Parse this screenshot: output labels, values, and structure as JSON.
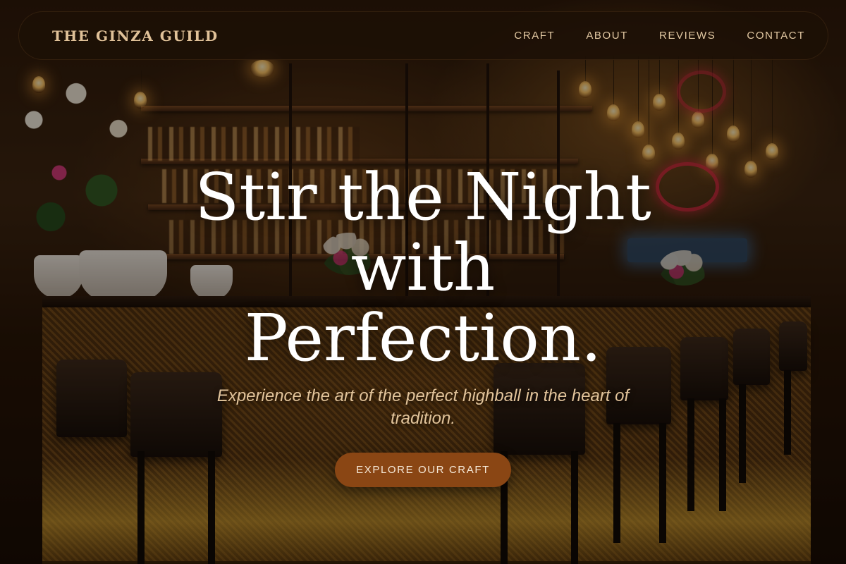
{
  "brand": {
    "name": "THE GINZA GUILD"
  },
  "nav": {
    "items": [
      {
        "label": "CRAFT"
      },
      {
        "label": "ABOUT"
      },
      {
        "label": "REVIEWS"
      },
      {
        "label": "CONTACT"
      }
    ]
  },
  "hero": {
    "title_line1": "Stir the Night with",
    "title_line2": "Perfection.",
    "subtitle": "Experience the art of the perfect highball in the heart of tradition.",
    "cta_label": "EXPLORE OUR CRAFT",
    "background": "bar-interior-photo"
  },
  "colors": {
    "accent": "#8a4614",
    "brand_text": "#e0c198",
    "nav_text": "#e3c9a3",
    "subtitle_text": "#e2c49b",
    "title_text": "#ffffff",
    "navbar_bg": "#1c1006"
  }
}
